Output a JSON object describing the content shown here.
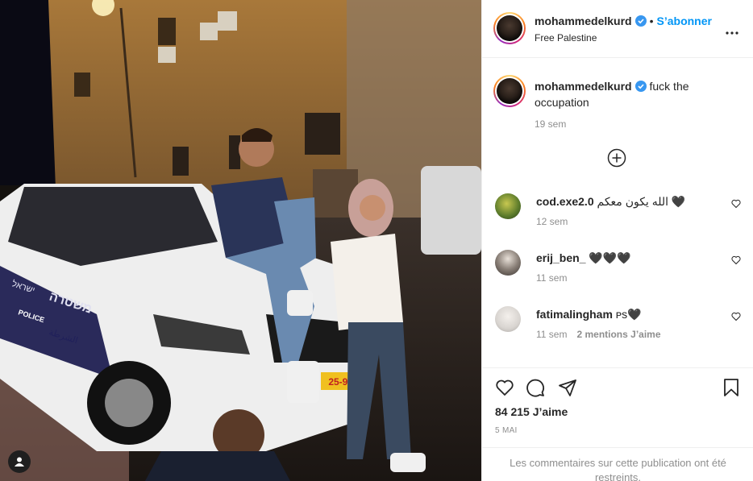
{
  "post": {
    "username": "mohammedelkurd",
    "follow_label": "S’abonner",
    "location": "Free Palestine",
    "dot": "•"
  },
  "caption": {
    "username": "mohammedelkurd",
    "text": "fuck the occupation",
    "time": "19 sem"
  },
  "comments": [
    {
      "username": "cod.exe2.0",
      "text": "الله يكون معكم 🖤",
      "time": "12 sem",
      "likes": "",
      "avatar_color": "#5a7a2a"
    },
    {
      "username": "erij_ben_",
      "text": "🖤🖤🖤",
      "time": "11 sem",
      "likes": "",
      "avatar_color": "#8a8078"
    },
    {
      "username": "fatimalingham",
      "text": "ᴘs🖤",
      "time": "11 sem",
      "likes": "2 mentions J’aime",
      "avatar_color": "#d8d4d0"
    }
  ],
  "stats": {
    "likes": "84 215 J’aime",
    "date": "5 MAI"
  },
  "restricted_text": "Les commentaires sur cette publication ont été restreints.",
  "car_text": {
    "hebrew": "משטרה",
    "police": "POLICE",
    "arabic": "الشرطة",
    "plate": "25-907",
    "side": "ישראל"
  },
  "colors": {
    "accent": "#0095f6",
    "verified": "#3897f0",
    "muted": "#8e8e8e"
  },
  "icons": [
    "tag-icon",
    "verified-icon",
    "more-icon",
    "load-more-icon",
    "heart-icon",
    "comment-icon",
    "share-icon",
    "save-icon"
  ]
}
